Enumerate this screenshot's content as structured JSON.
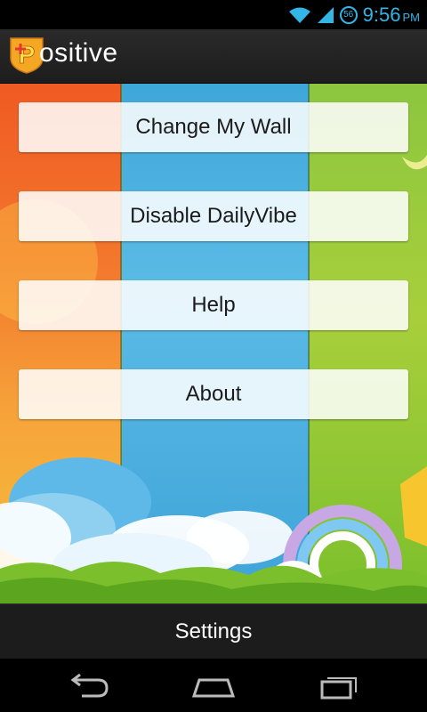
{
  "status_bar": {
    "time": "9:56",
    "ampm": "PM",
    "badge": "56",
    "icons": [
      "wifi-icon",
      "signal-icon",
      "notification-badge-icon"
    ]
  },
  "action_bar": {
    "title": "ositive",
    "logo_letter": "P",
    "logo_icon": "positive-logo-icon"
  },
  "menu": {
    "buttons": [
      {
        "label": "Change My Wall"
      },
      {
        "label": "Disable DailyVibe"
      },
      {
        "label": "Help"
      },
      {
        "label": "About"
      }
    ]
  },
  "settings_label": "Settings",
  "navigation": {
    "icons": [
      "back-icon",
      "home-icon",
      "recent-apps-icon"
    ]
  },
  "colors": {
    "accent": "#33b5e5",
    "stripe_orange": "#f3782d",
    "stripe_blue": "#4fb3e2",
    "stripe_green": "#8cc63f"
  }
}
